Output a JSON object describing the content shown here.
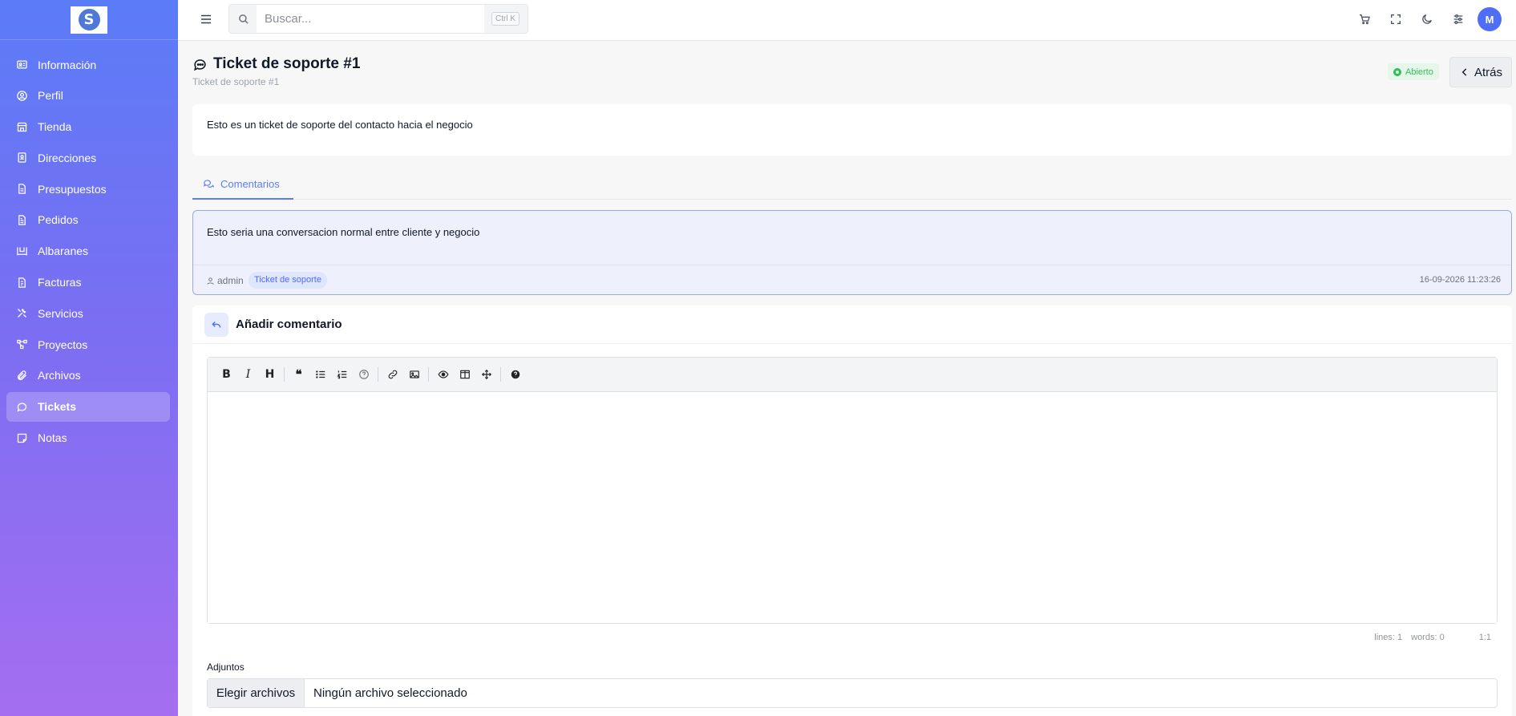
{
  "sidebar": {
    "items": [
      {
        "label": "Información",
        "icon": "id-card-icon"
      },
      {
        "label": "Perfil",
        "icon": "user-circle-icon"
      },
      {
        "label": "Tienda",
        "icon": "store-icon"
      },
      {
        "label": "Direcciones",
        "icon": "address-book-icon"
      },
      {
        "label": "Presupuestos",
        "icon": "file-text-icon"
      },
      {
        "label": "Pedidos",
        "icon": "file-invoice-icon"
      },
      {
        "label": "Albaranes",
        "icon": "pallet-icon"
      },
      {
        "label": "Facturas",
        "icon": "invoice-icon"
      },
      {
        "label": "Servicios",
        "icon": "tools-icon"
      },
      {
        "label": "Proyectos",
        "icon": "project-diagram-icon"
      },
      {
        "label": "Archivos",
        "icon": "paperclip-icon"
      },
      {
        "label": "Tickets",
        "icon": "chat-icon",
        "active": true
      },
      {
        "label": "Notas",
        "icon": "sticky-note-icon"
      }
    ]
  },
  "topbar": {
    "search_placeholder": "Buscar...",
    "shortcut": "Ctrl K",
    "avatar_initial": "M"
  },
  "page": {
    "title": "Ticket de soporte #1",
    "breadcrumb": "Ticket de soporte #1",
    "status": "Abierto",
    "back_label": "Atrás",
    "description": "Esto es un ticket de soporte del contacto hacia el negocio"
  },
  "tabs": [
    {
      "label": "Comentarios"
    }
  ],
  "comment": {
    "body": "Esto seria una conversacion normal entre cliente y negocio",
    "author": "admin",
    "tag": "Ticket de soporte",
    "timestamp": "16-09-2026 11:23:26"
  },
  "add_comment": {
    "title": "Añadir comentario",
    "status_lines": "lines: 1",
    "status_words": "words: 0",
    "status_cursor": "1:1",
    "attachments_label": "Adjuntos",
    "file_button": "Elegir archivos",
    "file_none": "Ningún archivo seleccionado"
  },
  "colors": {
    "accent": "#5b7cf7",
    "status_open": "#2fbf5a",
    "sidebar_gradient_top": "#5b7cf7",
    "sidebar_gradient_bottom": "#a56ef0"
  }
}
